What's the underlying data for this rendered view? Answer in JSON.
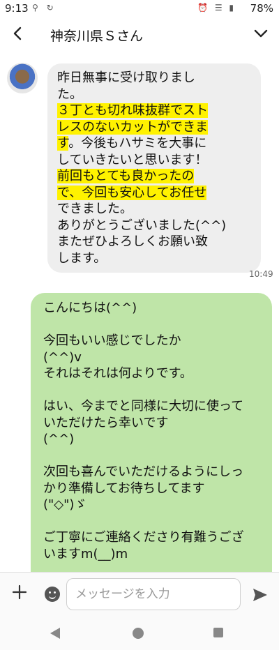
{
  "status_bar": {
    "time": "9:13",
    "left_icons": "⚲ ↻",
    "right_icons": "⏰ ☰ ▮",
    "battery": "78%"
  },
  "header": {
    "title": "神奈川県Ｓさん",
    "back_glyph": "‹",
    "colors": {
      "text": "#111111"
    }
  },
  "messages": {
    "incoming": {
      "line1": "昨日無事に受け取りまし",
      "line2": "た。",
      "hl1": "３丁とも切れ味抜群でスト",
      "hl2": "レスのないカットができま",
      "hl3": "す",
      "line5_rest": "。今後もハサミを大事に",
      "line6": "していきたいと思います！",
      "hl4": "前回もとても良かったの",
      "hl5": "で、今回も安心してお任せ",
      "line9": "できました。",
      "line10": "ありがとうございました(^^)",
      "line11": "またぜひよろしくお願い致",
      "line12": "します。",
      "timestamp": "10:49"
    },
    "outgoing": {
      "l1": "こんにちは(^^)",
      "l2": "今回もいい感じでしたか",
      "l3": "(^^)v",
      "l4": "それはそれは何よりです。",
      "l5": "はい、今までと同様に大切に使って",
      "l6": "いただけたら幸いです",
      "l7": "(^^)",
      "l8": "次回も喜んでいただけるようにしっ",
      "l9": "かり準備してお待ちしてます",
      "l10": "(\"◇\")ゞ",
      "l11": "ご丁寧にご連絡くださり有難うござ",
      "l12": "いますm(__)m"
    },
    "colors": {
      "incoming_bg": "#eeeeee",
      "outgoing_bg": "#bfe5a8",
      "highlight": "#fff200"
    }
  },
  "input": {
    "placeholder": "メッセージを入力",
    "value": ""
  }
}
